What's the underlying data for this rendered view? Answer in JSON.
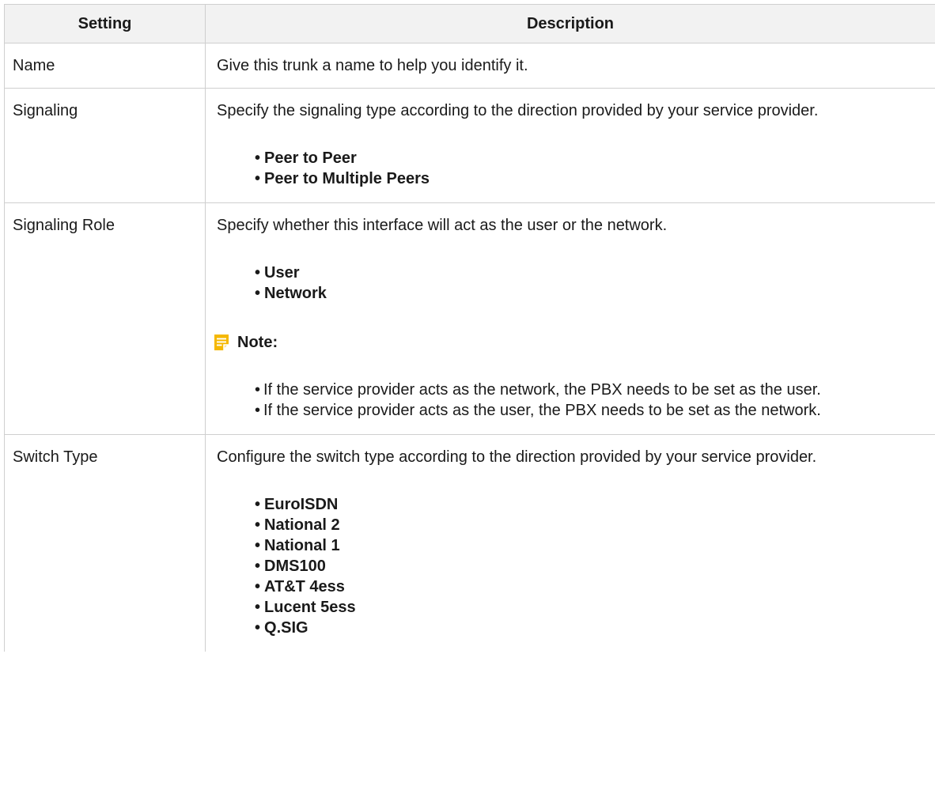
{
  "header": {
    "setting": "Setting",
    "description": "Description"
  },
  "rows": [
    {
      "setting": "Name",
      "description": "Give this trunk a name to help you identify it."
    },
    {
      "setting": "Signaling",
      "description": "Specify the signaling type according to the direction provided by your service provider.",
      "options": [
        "Peer to Peer",
        "Peer to Multiple Peers"
      ]
    },
    {
      "setting": "Signaling Role",
      "description": "Specify whether this interface will act as the user or the network.",
      "options": [
        "User",
        "Network"
      ],
      "note_label": "Note:",
      "notes": [
        "If the service provider acts as the network, the PBX needs to be set as the user.",
        "If the service provider acts as the user, the PBX needs to be set as the network."
      ]
    },
    {
      "setting": "Switch Type",
      "description": "Configure the switch type according to the direction provided by your service provider.",
      "options": [
        "EuroISDN",
        "National 2",
        "National 1",
        "DMS100",
        "AT&T 4ess",
        "Lucent 5ess",
        "Q.SIG"
      ]
    }
  ],
  "icons": {
    "note": "note-icon"
  },
  "colors": {
    "note_icon": "#f5b800",
    "header_bg": "#f2f2f2",
    "border": "#cfcfcf"
  }
}
